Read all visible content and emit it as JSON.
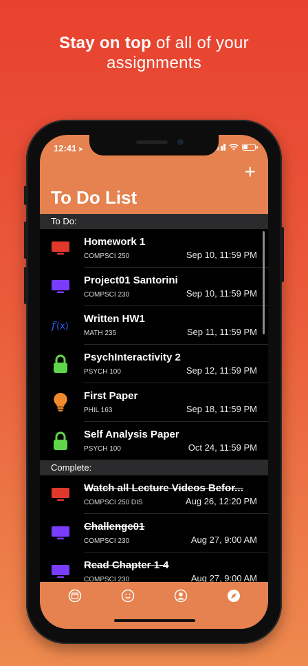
{
  "headline": {
    "bold": "Stay on top",
    "rest": " of all of your",
    "line2": "assignments"
  },
  "status": {
    "time": "12:41",
    "location_icon": "location-arrow-icon"
  },
  "nav": {
    "add_label": "+",
    "title": "To Do List"
  },
  "sections": {
    "todo": "To Do:",
    "complete": "Complete:"
  },
  "todo_items": [
    {
      "name": "Homework 1",
      "course": "COMPSCI 250",
      "due": "Sep 10, 11:59 PM",
      "icon": "monitor-icon",
      "color": "#e0392c"
    },
    {
      "name": "Project01 Santorini",
      "course": "COMPSCI 230",
      "due": "Sep 10, 11:59 PM",
      "icon": "monitor-icon",
      "color": "#7a3cff"
    },
    {
      "name": "Written HW1",
      "course": "MATH 235",
      "due": "Sep 11, 11:59 PM",
      "icon": "function-icon",
      "color": "#2f5dff"
    },
    {
      "name": "PsychInteractivity 2",
      "course": "PSYCH 100",
      "due": "Sep 12, 11:59 PM",
      "icon": "lock-icon",
      "color": "#5fd64a"
    },
    {
      "name": "First Paper",
      "course": "PHIL 163",
      "due": "Sep 18, 11:59 PM",
      "icon": "lightbulb-icon",
      "color": "#f08a2c"
    },
    {
      "name": "Self Analysis Paper",
      "course": "PSYCH 100",
      "due": "Oct 24, 11:59 PM",
      "icon": "lock-icon",
      "color": "#5fd64a"
    }
  ],
  "complete_items": [
    {
      "name": "Watch all Lecture Videos Befor...",
      "course": "COMPSCI 250 DIS",
      "due": "Aug 26, 12:20 PM",
      "icon": "monitor-icon",
      "color": "#e0392c"
    },
    {
      "name": "Challenge01",
      "course": "COMPSCI 230",
      "due": "Aug 27, 9:00 AM",
      "icon": "monitor-icon",
      "color": "#7a3cff"
    },
    {
      "name": "Read Chapter 1-4",
      "course": "COMPSCI 230",
      "due": "Aug 27, 9:00 AM",
      "icon": "monitor-icon",
      "color": "#7a3cff"
    }
  ],
  "tabs": [
    {
      "icon": "calendar-icon"
    },
    {
      "icon": "smiley-icon"
    },
    {
      "icon": "profile-icon"
    },
    {
      "icon": "compass-icon"
    }
  ],
  "colors": {
    "accent": "#e5824f",
    "background_top": "#e8412f",
    "background_bottom": "#ee8a4e"
  }
}
